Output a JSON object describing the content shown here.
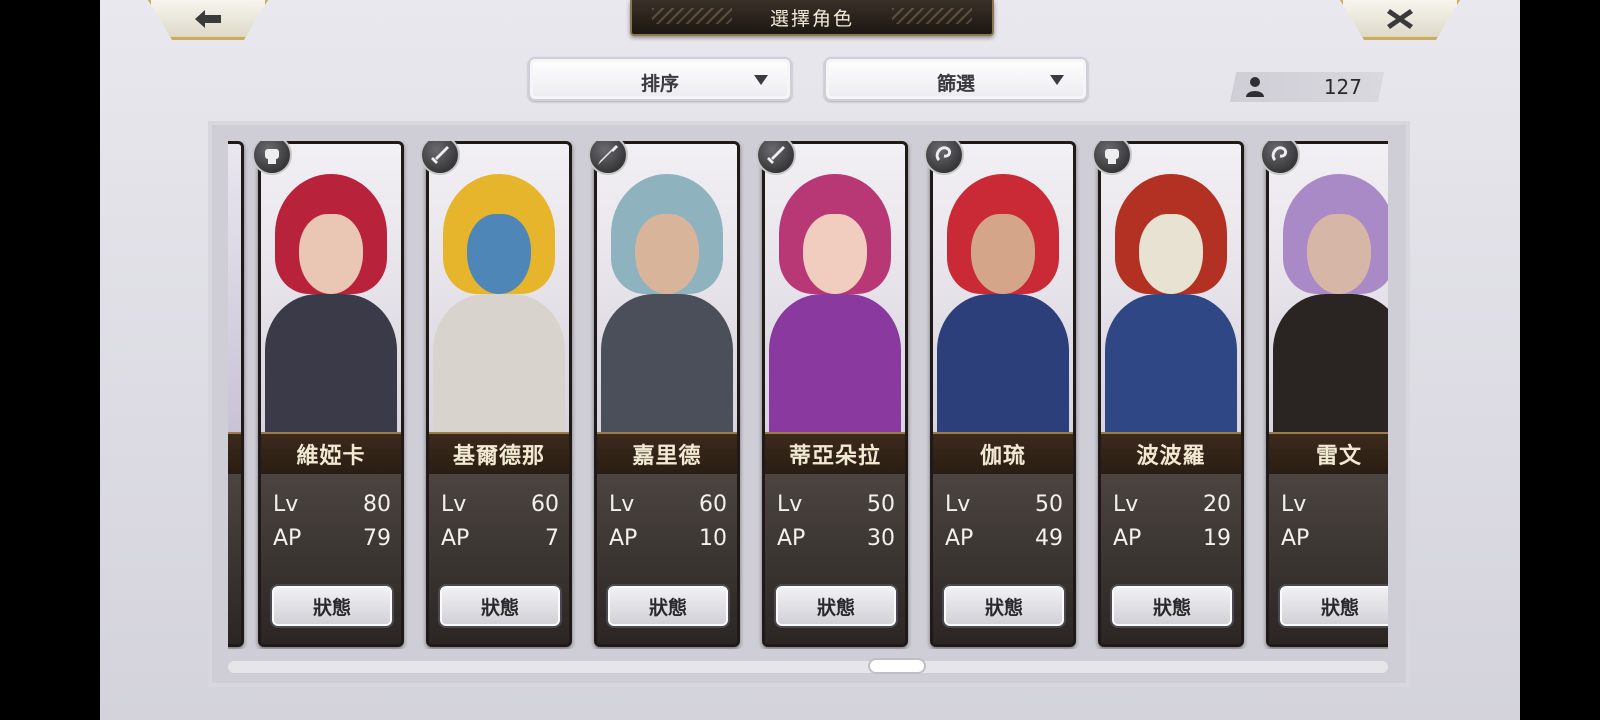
{
  "header": {
    "title": "選擇角色"
  },
  "toolbar": {
    "sort_label": "排序",
    "filter_label": "篩選",
    "character_count": "127"
  },
  "icons": {
    "back": "arrow-left-icon",
    "close": "close-icon",
    "count": "person-icon"
  },
  "cards": [
    {
      "name": "維婭卡",
      "lv_label": "Lv",
      "lv": "80",
      "ap_label": "AP",
      "ap": "79",
      "status_label": "狀態",
      "type_icon": "fist-icon",
      "hair": "#b8223a",
      "skin": "#e9c7b4",
      "outfit": "#3b3a48"
    },
    {
      "name": "基爾德那",
      "lv_label": "Lv",
      "lv": "60",
      "ap_label": "AP",
      "ap": "7",
      "status_label": "狀態",
      "type_icon": "sword-icon",
      "hair": "#e7b52b",
      "skin": "#4f86b8",
      "outfit": "#d8d3cc"
    },
    {
      "name": "嘉里德",
      "lv_label": "Lv",
      "lv": "60",
      "ap_label": "AP",
      "ap": "10",
      "status_label": "狀態",
      "type_icon": "spear-icon",
      "hair": "#8fb2bf",
      "skin": "#d8b49b",
      "outfit": "#4a4f5a"
    },
    {
      "name": "蒂亞朵拉",
      "lv_label": "Lv",
      "lv": "50",
      "ap_label": "AP",
      "ap": "30",
      "status_label": "狀態",
      "type_icon": "sword-icon",
      "hair": "#b83876",
      "skin": "#f0cdbf",
      "outfit": "#8a3a9e"
    },
    {
      "name": "伽琉",
      "lv_label": "Lv",
      "lv": "50",
      "ap_label": "AP",
      "ap": "49",
      "status_label": "狀態",
      "type_icon": "whip-icon",
      "hair": "#c92a36",
      "skin": "#d5a58a",
      "outfit": "#2c3f7a"
    },
    {
      "name": "波波羅",
      "lv_label": "Lv",
      "lv": "20",
      "ap_label": "AP",
      "ap": "19",
      "status_label": "狀態",
      "type_icon": "fist-icon",
      "hair": "#b33122",
      "skin": "#e7e2d2",
      "outfit": "#2f4785"
    },
    {
      "name": "雷文",
      "lv_label": "Lv",
      "lv": "",
      "ap_label": "AP",
      "ap": "",
      "status_label": "狀態",
      "type_icon": "whip-icon",
      "hair": "#a989c6",
      "skin": "#d6b6a6",
      "outfit": "#2a2522"
    }
  ],
  "colors": {
    "accent_gold": "#c9ad5e",
    "panel_bg": "#cfced6",
    "name_bar": "#2a1d13"
  }
}
